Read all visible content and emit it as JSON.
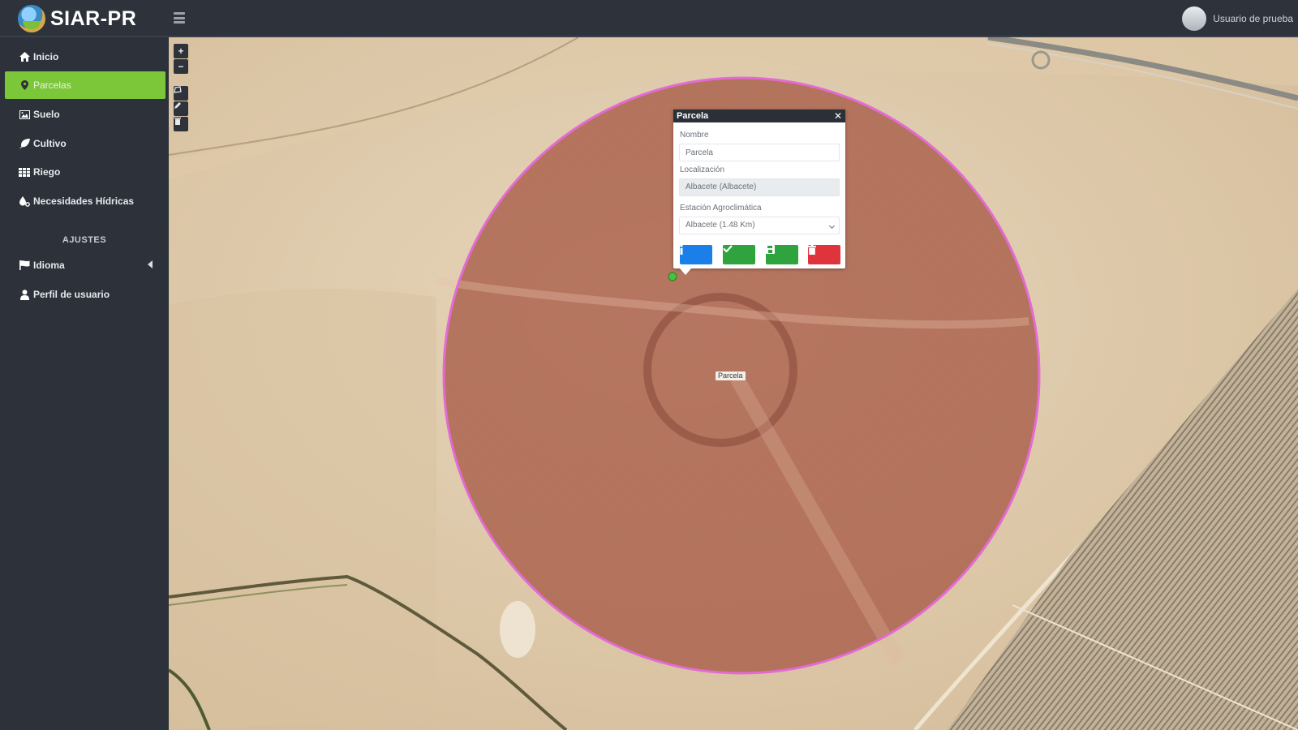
{
  "app": {
    "title": "SIAR-PR"
  },
  "user": {
    "name": "Usuario de prueba"
  },
  "sidebar": {
    "items": [
      {
        "label": "Inicio",
        "icon": "home-icon"
      },
      {
        "label": "Parcelas",
        "icon": "map-marker-icon",
        "active": true
      },
      {
        "label": "Suelo",
        "icon": "image-icon"
      },
      {
        "label": "Cultivo",
        "icon": "leaf-icon"
      },
      {
        "label": "Riego",
        "icon": "table-icon"
      },
      {
        "label": "Necesidades Hídricas",
        "icon": "water-icon"
      }
    ],
    "section_title": "AJUSTES",
    "settings_items": [
      {
        "label": "Idioma",
        "icon": "flag-icon"
      },
      {
        "label": "Perfil de usuario",
        "icon": "user-icon"
      }
    ]
  },
  "map": {
    "parcel_label": "Parcela",
    "colors": {
      "parcel_outline": "#e46ad4",
      "parcel_fill": "#a2523f",
      "marker": "#43c43a"
    }
  },
  "popup": {
    "title": "Parcela",
    "name_label": "Nombre",
    "name_value": "Parcela",
    "location_label": "Localización",
    "location_value": "Albacete (Albacete)",
    "station_label": "Estación Agroclimática",
    "station_value": "Albacete (1.48 Km)",
    "buttons": [
      {
        "name": "info",
        "color": "#1a7fe8"
      },
      {
        "name": "confirm",
        "color": "#2fa33d"
      },
      {
        "name": "save",
        "color": "#2fa33d"
      },
      {
        "name": "delete",
        "color": "#e0343d"
      }
    ]
  },
  "colors": {
    "sidebar_bg": "#2d323a",
    "accent": "#7cc63a"
  }
}
